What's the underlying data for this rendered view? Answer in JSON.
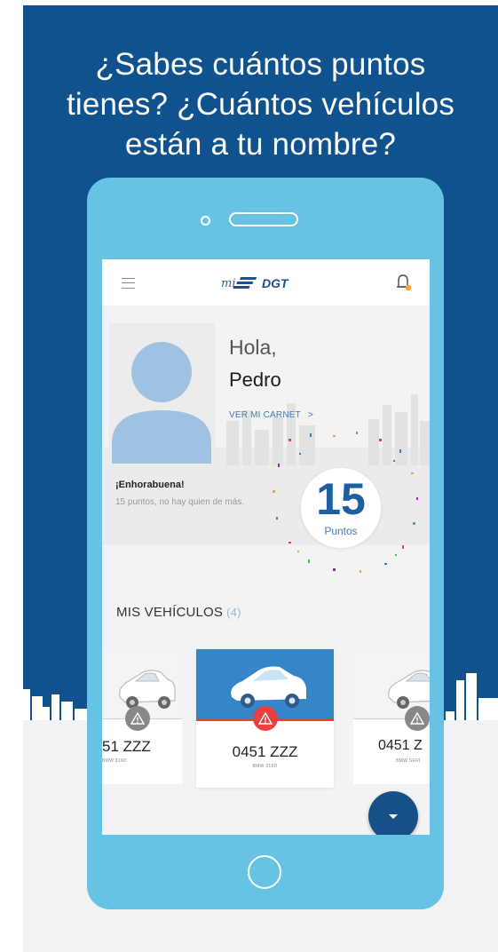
{
  "promo": {
    "headline_line1": "¿Sabes cuántos puntos",
    "headline_line2": "tienes? ¿Cuántos vehículos",
    "headline_line3": "están a tu nombre?"
  },
  "app": {
    "logo_text": "mi DGT",
    "greeting": "Hola,",
    "user_name": "Pedro",
    "view_license_link": "VER MI CARNET",
    "view_license_arrow": ">",
    "congrats_title": "¡Enhorabuena!",
    "congrats_message": "15 puntos, no hay quien de más.",
    "points_value": "15",
    "points_label": "Puntos"
  },
  "vehicles": {
    "section_title": "MIS VEHÍCULOS",
    "count": "(4)",
    "items": [
      {
        "plate": "51 ZZZ",
        "model": "BMW 316D",
        "alert": "grey"
      },
      {
        "plate": "0451 ZZZ",
        "model": "BMW 316D",
        "alert": "red"
      },
      {
        "plate": "0451 Z",
        "model": "BMW SERI",
        "alert": "grey"
      }
    ]
  },
  "colors": {
    "background_blue": "#10528e",
    "phone_body": "#66c3e3",
    "accent_blue": "#1e5fa0",
    "alert_red": "#e84040",
    "fab_blue": "#174f88"
  },
  "icons": [
    "menu-icon",
    "bell-icon",
    "warning-icon",
    "chevron-down-icon",
    "avatar-icon",
    "car-icon"
  ]
}
